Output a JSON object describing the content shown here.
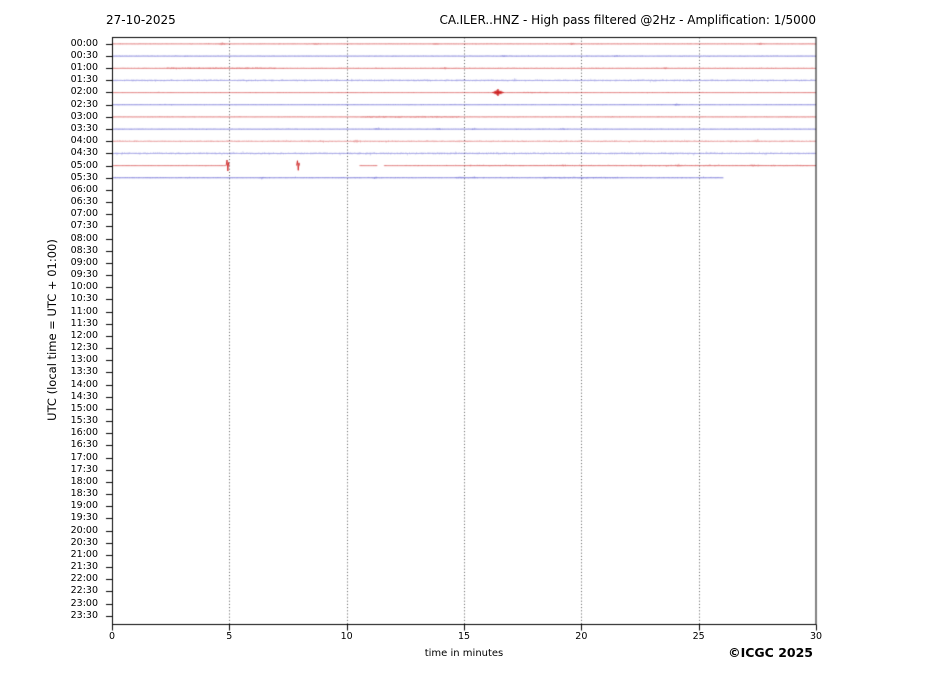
{
  "footer": {
    "copyright": "©ICGC 2025"
  },
  "chart_data": {
    "type": "line",
    "subtype": "helicorder-seismogram",
    "date_label": "27-10-2025",
    "title": "CA.ILER..HNZ - High pass filtered @2Hz - Amplification: 1/5000",
    "xlabel": "time in minutes",
    "ylabel": "UTC (local time = UTC + 01:00)",
    "xlim": [
      0,
      30
    ],
    "xticks": [
      0,
      5,
      10,
      15,
      20,
      25,
      30
    ],
    "grid_x_minutes": [
      5,
      10,
      15,
      20,
      25
    ],
    "row_interval_minutes": 30,
    "legend": "none",
    "grid": "vertical-dotted",
    "colors": {
      "red": "#cc1f1f",
      "blue": "#3333c3",
      "grid": "#444444",
      "frame": "#000000"
    },
    "rows": [
      {
        "label": "00:00",
        "color": "red",
        "amp": 0.5,
        "events": [
          {
            "t": 4.7,
            "k": "blip",
            "h": 2.0
          },
          {
            "t": 8.7,
            "k": "blip",
            "h": 1.0
          },
          {
            "t": 13.8,
            "k": "blip",
            "h": 1.1
          },
          {
            "t": 19.6,
            "k": "blip",
            "h": 1.2
          },
          {
            "t": 27.6,
            "k": "blip",
            "h": 1.3
          }
        ]
      },
      {
        "label": "00:30",
        "color": "blue",
        "amp": 0.5,
        "events": [
          {
            "t": 16.7,
            "k": "blip",
            "h": 1.3
          },
          {
            "t": 21.5,
            "k": "blip",
            "h": 0.9
          }
        ]
      },
      {
        "label": "01:00",
        "color": "red",
        "amp": 0.55,
        "regions": [
          [
            2.3,
            7.0,
            1.1
          ]
        ],
        "events": [
          {
            "t": 14.2,
            "k": "blip",
            "h": 1.2
          },
          {
            "t": 23.6,
            "k": "blip",
            "h": 0.9
          }
        ]
      },
      {
        "label": "01:30",
        "color": "blue",
        "amp": 1.25,
        "light": true
      },
      {
        "label": "02:00",
        "color": "red",
        "amp": 0.5,
        "regions": [
          [
            17.5,
            18.6,
            0.85
          ]
        ],
        "events": [
          {
            "t": 16.45,
            "k": "burst",
            "h": 3.6
          }
        ]
      },
      {
        "label": "02:30",
        "color": "blue",
        "amp": 0.5,
        "events": [
          {
            "t": 24.1,
            "k": "blip",
            "h": 1.4
          }
        ]
      },
      {
        "label": "03:00",
        "color": "red",
        "amp": 0.5,
        "regions": [
          [
            10.6,
            14.8,
            1.0
          ]
        ]
      },
      {
        "label": "03:30",
        "color": "blue",
        "amp": 0.5,
        "events": [
          {
            "t": 11.3,
            "k": "blip",
            "h": 1.1
          },
          {
            "t": 13.9,
            "k": "blip",
            "h": 1.1
          },
          {
            "t": 15.4,
            "k": "blip",
            "h": 1.1
          },
          {
            "t": 19.2,
            "k": "blip",
            "h": 1.0
          }
        ]
      },
      {
        "label": "04:00",
        "color": "red",
        "amp": 1.05,
        "light": true,
        "events": [
          {
            "t": 10.4,
            "k": "blip",
            "h": 1.3
          },
          {
            "t": 27.5,
            "k": "blip",
            "h": 1.1
          }
        ]
      },
      {
        "label": "04:30",
        "color": "blue",
        "amp": 1.35,
        "light": true
      },
      {
        "label": "05:00",
        "color": "red",
        "amp": 0.6,
        "segments": [
          [
            0,
            4.85
          ],
          [
            10.55,
            11.3
          ],
          [
            11.6,
            30
          ]
        ],
        "regions": [
          [
            15,
            30,
            0.85
          ]
        ],
        "events": [
          {
            "t": 4.92,
            "k": "spike",
            "h": 5.5
          },
          {
            "t": 7.92,
            "k": "spike",
            "h": 4.8
          },
          {
            "t": 19.2,
            "k": "blip",
            "h": 1.0
          },
          {
            "t": 24.1,
            "k": "blip",
            "h": 0.9
          },
          {
            "t": 27.3,
            "k": "blip",
            "h": 0.9
          }
        ]
      },
      {
        "label": "05:30",
        "color": "blue",
        "amp": 0.7,
        "segments": [
          [
            0,
            26.05
          ]
        ],
        "regions": [
          [
            14.6,
            15.6,
            1.2
          ],
          [
            18.4,
            21.6,
            1.05
          ]
        ],
        "events": [
          {
            "t": 6.4,
            "k": "blip",
            "h": 1.2
          },
          {
            "t": 11.2,
            "k": "blip",
            "h": 1.0
          }
        ]
      },
      {
        "label": "06:00",
        "color": null
      },
      {
        "label": "06:30",
        "color": null
      },
      {
        "label": "07:00",
        "color": null
      },
      {
        "label": "07:30",
        "color": null
      },
      {
        "label": "08:00",
        "color": null
      },
      {
        "label": "08:30",
        "color": null
      },
      {
        "label": "09:00",
        "color": null
      },
      {
        "label": "09:30",
        "color": null
      },
      {
        "label": "10:00",
        "color": null
      },
      {
        "label": "10:30",
        "color": null
      },
      {
        "label": "11:00",
        "color": null
      },
      {
        "label": "11:30",
        "color": null
      },
      {
        "label": "12:00",
        "color": null
      },
      {
        "label": "12:30",
        "color": null
      },
      {
        "label": "13:00",
        "color": null
      },
      {
        "label": "13:30",
        "color": null
      },
      {
        "label": "14:00",
        "color": null
      },
      {
        "label": "14:30",
        "color": null
      },
      {
        "label": "15:00",
        "color": null
      },
      {
        "label": "15:30",
        "color": null
      },
      {
        "label": "16:00",
        "color": null
      },
      {
        "label": "16:30",
        "color": null
      },
      {
        "label": "17:00",
        "color": null
      },
      {
        "label": "17:30",
        "color": null
      },
      {
        "label": "18:00",
        "color": null
      },
      {
        "label": "18:30",
        "color": null
      },
      {
        "label": "19:00",
        "color": null
      },
      {
        "label": "19:30",
        "color": null
      },
      {
        "label": "20:00",
        "color": null
      },
      {
        "label": "20:30",
        "color": null
      },
      {
        "label": "21:00",
        "color": null
      },
      {
        "label": "21:30",
        "color": null
      },
      {
        "label": "22:00",
        "color": null
      },
      {
        "label": "22:30",
        "color": null
      },
      {
        "label": "23:00",
        "color": null
      },
      {
        "label": "23:30",
        "color": null
      }
    ]
  }
}
